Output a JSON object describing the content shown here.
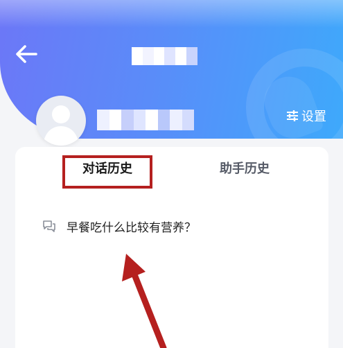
{
  "header": {
    "settings_label": "设置",
    "gradient_start": "#6c77f7",
    "gradient_end": "#3ea9fb"
  },
  "tabs": [
    {
      "label": "对话历史",
      "active": true
    },
    {
      "label": "助手历史",
      "active": false
    }
  ],
  "history": [
    {
      "text": "早餐吃什么比较有营养？",
      "icon": "chat-bubble-icon"
    }
  ],
  "annotation": {
    "highlight_color": "#b5201f",
    "arrow_color": "#b5201f"
  },
  "icons": {
    "back": "back-arrow-icon",
    "settings": "sliders-icon",
    "avatar": "user-avatar-icon"
  }
}
